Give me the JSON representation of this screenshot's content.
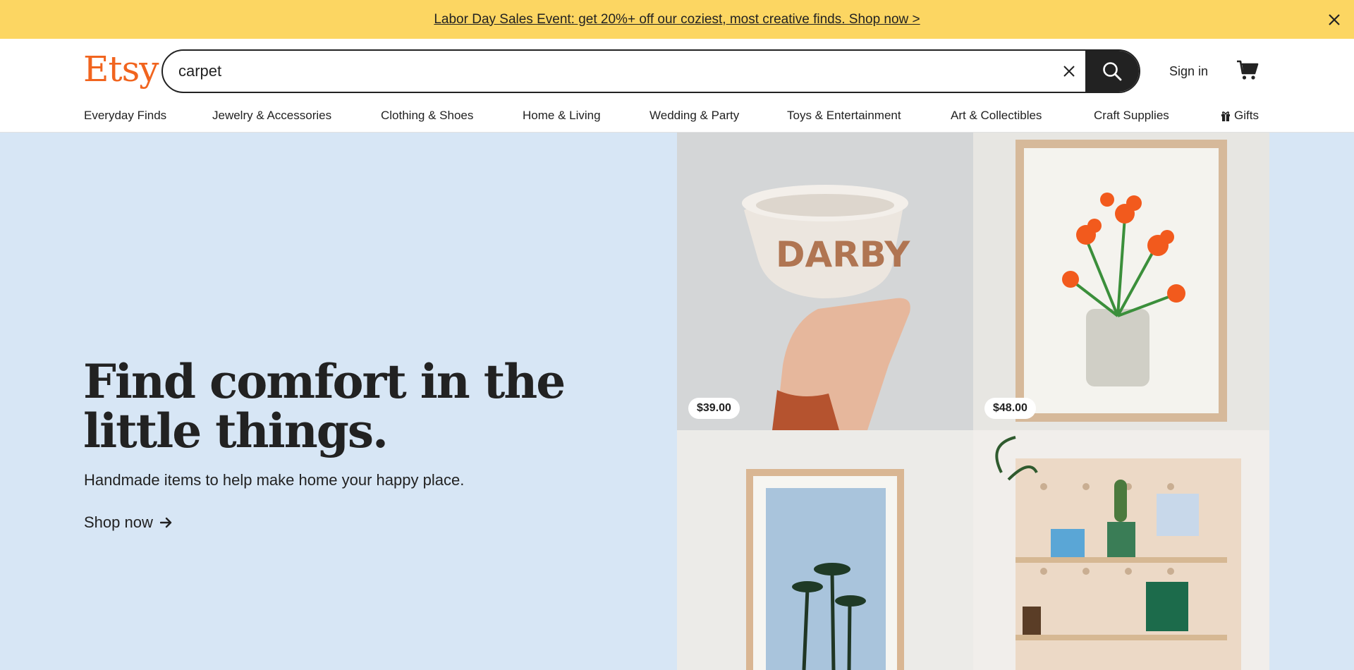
{
  "promo": {
    "text": "Labor Day Sales Event: get 20%+ off our coziest, most creative finds. Shop now >"
  },
  "header": {
    "logo": "Etsy",
    "search_value": "carpet",
    "signin_label": "Sign in"
  },
  "categories": [
    "Everyday Finds",
    "Jewelry & Accessories",
    "Clothing & Shoes",
    "Home & Living",
    "Wedding & Party",
    "Toys & Entertainment",
    "Art & Collectibles",
    "Craft Supplies",
    "Gifts"
  ],
  "hero": {
    "headline": "Find comfort in the little things.",
    "subhead": "Handmade items to help make home your happy place.",
    "cta": "Shop now"
  },
  "tiles": [
    {
      "price": "$39.00"
    },
    {
      "price": "$48.00"
    },
    {
      "price": ""
    },
    {
      "price": ""
    }
  ],
  "colors": {
    "promo_bg": "#fcd662",
    "brand": "#f1641e",
    "hero_bg": "#d7e6f5"
  }
}
